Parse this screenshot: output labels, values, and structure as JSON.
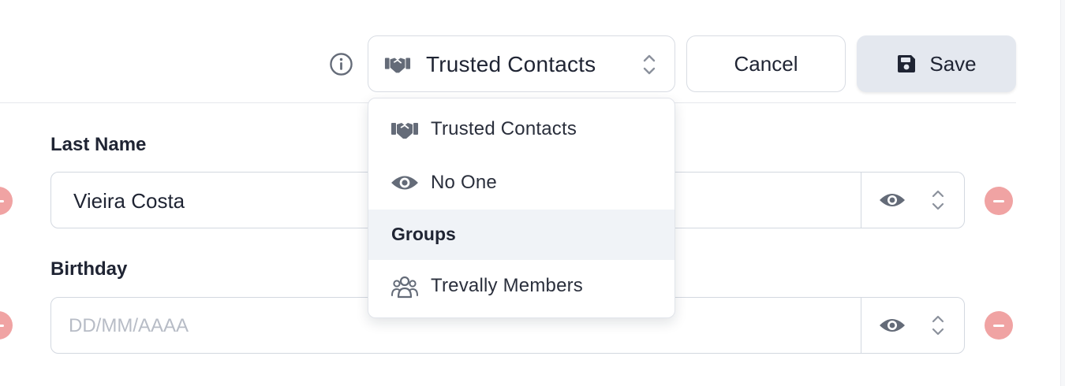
{
  "header": {
    "visibility_select": {
      "selected_label": "Trusted Contacts",
      "lead_icon": "handshake-icon"
    },
    "cancel_label": "Cancel",
    "save_label": "Save"
  },
  "dropdown": {
    "options": [
      {
        "label": "Trusted Contacts",
        "icon": "handshake-icon"
      },
      {
        "label": "No One",
        "icon": "eye-icon"
      }
    ],
    "group_header": "Groups",
    "group_options": [
      {
        "label": "Trevally Members",
        "icon": "users-icon"
      }
    ]
  },
  "fields": {
    "last_name": {
      "label": "Last Name",
      "value": "Vieira Costa"
    },
    "birthday": {
      "label": "Birthday",
      "placeholder": "DD/MM/AAAA"
    }
  },
  "colors": {
    "remove": "#f0a3a3",
    "save_bg": "#e4e8ef",
    "icon_gray": "#646b78"
  }
}
